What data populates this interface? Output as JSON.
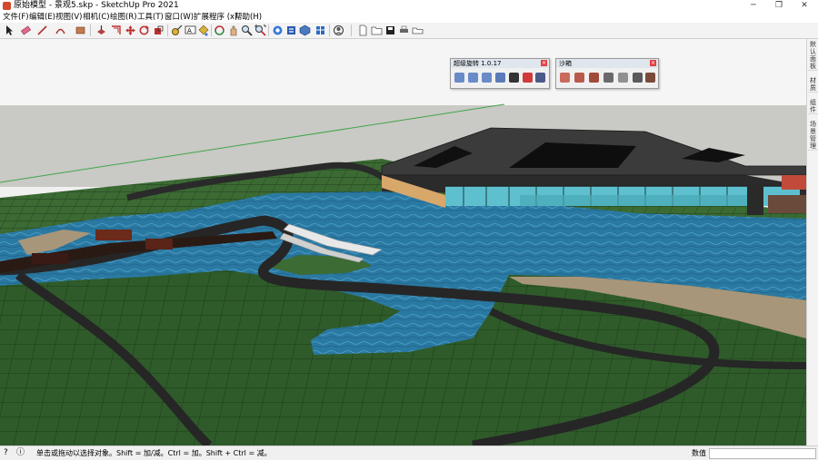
{
  "window": {
    "title": "原始模型 - 景观5.skp - SketchUp Pro 2021",
    "minimize_glyph": "─",
    "maximize_glyph": "❐",
    "close_glyph": "✕"
  },
  "menu": {
    "items": [
      "文件(F)",
      "编辑(E)",
      "视图(V)",
      "相机(C)",
      "绘图(R)",
      "工具(T)",
      "窗口(W)",
      "扩展程序 (x)",
      "帮助(H)"
    ]
  },
  "toolbar": {
    "icons": [
      "select-icon",
      "eraser-icon",
      "line-icon",
      "arc-icon",
      "shape-icon",
      "push-pull-icon",
      "offset-icon",
      "move-icon",
      "rotate-icon",
      "scale-icon",
      "tape-measure-icon",
      "text-icon",
      "paint-bucket-icon",
      "orbit-icon",
      "pan-icon",
      "zoom-icon",
      "zoom-extents-icon",
      "warehouse-icon",
      "extension-icon",
      "components-icon",
      "styles-icon",
      "user-icon",
      "file-icon",
      "folder-icon",
      "save-icon",
      "print-icon",
      "layer-icon"
    ]
  },
  "floating_toolbars": [
    {
      "title": "超级旋转 1.0.17",
      "close": "×",
      "button_count": 7
    },
    {
      "title": "沙箱",
      "close": "×",
      "button_count": 7
    }
  ],
  "tray": {
    "tabs": [
      "默认面板",
      "材质",
      "组件",
      "场景管理"
    ]
  },
  "status": {
    "help_icon": "?",
    "info_icon": "ⓘ",
    "text": "单击或拖动以选择对象。Shift = 加/减。Ctrl = 加。Shift + Ctrl = 减。",
    "measurements_label": "数值",
    "measurements_value": ""
  },
  "colors": {
    "grass": "#2e5a2a",
    "water": "#2a78a0",
    "road": "#2a2a2a",
    "sand": "#a8967a",
    "sky": "#f4f4f4",
    "ground_far": "#c8c8c4"
  }
}
